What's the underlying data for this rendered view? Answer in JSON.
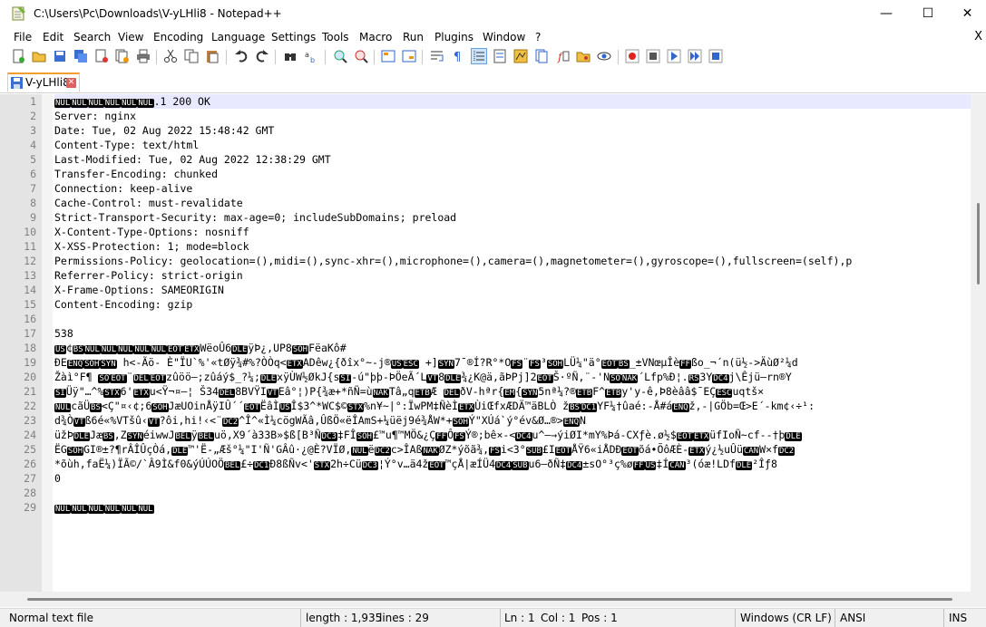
{
  "window": {
    "title": "C:\\Users\\Pc\\Downloads\\V-yLHli8 - Notepad++",
    "minimize": "—",
    "maximize": "☐",
    "close": "✕"
  },
  "menu": [
    "File",
    "Edit",
    "Search",
    "View",
    "Encoding",
    "Language",
    "Settings",
    "Tools",
    "Macro",
    "Run",
    "Plugins",
    "Window",
    "?"
  ],
  "menu_close": "X",
  "tab": {
    "label": "V-yLHli8",
    "close": "✕"
  },
  "line_numbers": [
    "1",
    "2",
    "3",
    "4",
    "5",
    "6",
    "7",
    "8",
    "9",
    "10",
    "11",
    "12",
    "13",
    "14",
    "15",
    "16",
    "17",
    "18",
    "19",
    "20",
    "21",
    "22",
    "23",
    "24",
    "25",
    "26",
    "27",
    "28",
    "29"
  ],
  "lines": {
    "l1": ".1 200 OK",
    "l2": "Server: nginx",
    "l3": "Date: Tue, 02 Aug 2022 15:48:42 GMT",
    "l4": "Content-Type: text/html",
    "l5": "Last-Modified: Tue, 02 Aug 2022 12:38:29 GMT",
    "l6": "Transfer-Encoding: chunked",
    "l7": "Connection: keep-alive",
    "l8": "Cache-Control: must-revalidate",
    "l9": "Strict-Transport-Security: max-age=0; includeSubDomains; preload",
    "l10": "X-Content-Type-Options: nosniff",
    "l11": "X-XSS-Protection: 1; mode=block",
    "l12": "Permissions-Policy: geolocation=(),midi=(),sync-xhr=(),microphone=(),camera=(),magnetometer=(),gyroscope=(),fullscreen=(self),p",
    "l13": "Referrer-Policy: strict-origin",
    "l14": "X-Frame-Options: SAMEORIGIN",
    "l15": "Content-Encoding: gzip",
    "l16": "",
    "l17": "538",
    "l18b": "WëoÛ6",
    "l18c": "ÿÞ¿,UP8",
    "l18d": "FëaKô#",
    "l19a": "ÐE",
    "l19b": " h<-Ãö- È\"ÏU`%'«tØÿ¾#%?ÒÒq<",
    "l19c": "ADêw¿{ðîx°~-j®",
    "l19d": " +]",
    "l19e": "7¯®Í?R°*O",
    "l19f": "LÜ¼\"ä°",
    "l19g": "_±VNœµÎè",
    "l19h": "ßo_¬´n(ü½->ÄùØ²¼d",
    "l20a": "Žàì°F¶ ",
    "l20b": "zûöö—;zûáý$_?¼;",
    "l20c": "xÿÙW½ØkJ{s",
    "l20d": "-ú\"þþ-ÞÖeÃ´L",
    "l20e": "¾¿K@ä,ãÞPj]2",
    "l20f": "Š·ºÑ,¨-'N",
    "l20g": "´Lfp%Ð¦.",
    "l20h": "3Y",
    "l20i": "j\\Êjü—rn®Y",
    "l21a": "",
    "l21b": "Üÿ\"…^%",
    "l21c": "6'",
    "l21d": "u<Ÿ¬¤—¦ Š34",
    "l21e": "8BVŸI",
    "l21f": "Eâ°¦)P{¾æ+*ñÑ=ù",
    "l21g": "Tâ„q",
    "l21h": "ðV-hªr{",
    "l21i": "5nª¼?®",
    "l21j": "F^",
    "l21k": "y'y-ê,Þ8èââ$¯EÇ",
    "l21l": "uqtš×",
    "l22a": "cãÜ",
    "l22b": "<Ç\"¤‹¢;6",
    "l22c": "JæUOinÅÿIÛ´´",
    "l22d": "ËâÌ",
    "l22e": "Î$3^*WC$©",
    "l22f": "%n¥~|°:ÏwPM‡ÑèÌ",
    "l22g": "ÙiŒfxÆDÄ™äBLÒ ž",
    "l22h": "YF¼†ûaé:-Å#á",
    "l22i": "ž,-|GÖb=Œ>E´-km¢‹÷¹:",
    "l23a": "d¾Ò",
    "l23b": "ß6é«%VTšû‹",
    "l23c": "?ôi,hi!‹<¨",
    "l23d": "^Î^«Ì¼cögWÃâ,ÛßÖ«ëÎAmS+¼üëj9é¾ÅW*+",
    "l23e": "Ý\"XÚá`ý°év&Ø…®>",
    "l23f": "N",
    "l24a": "üžÞ",
    "l24b": "Jæ",
    "l24c": ",Z",
    "l24d": "éiwwJ",
    "l24e": "ÿ",
    "l24f": "uö,X9´à33B»$ß[B³Ñ",
    "l24g": "‡FÎ",
    "l24h": "£™u¶™MÖ&¿Ç",
    "l24i": "Ý®;bê×-<",
    "l24j": "u^—→ýiØI*mY%Þá-CXƒè.ø½$",
    "l24k": "üfIoÑ~cf--†þ",
    "l25a": "ËG",
    "l25b": "GI®±?¶rÂÎÛçÒá,",
    "l25c": "™'Ë-„Æš°¼\"I'Ñ'GÂû·¿@È?VÏØ,",
    "l25d": "ë",
    "l25e": "c>ÎAß",
    "l25f": "ØZ*ýõã¾,",
    "l25g": "i<3°",
    "l25h": "£I",
    "l25i": "ÅŸ6«iÅDÐ",
    "l25j": "õá•ÕôÆÈ-",
    "l25k": "ý¿½uÛü",
    "l25l": "W×f",
    "l26a": "*õùh,faË¼)ÏÃ©/`Â9Ì&f0&ýÚÚOÖ",
    "l26b": "£÷",
    "l26c": "Ð8ßÑv<'",
    "l26d": "2h÷Cü",
    "l26e": "¦Ý°v…ä4ž",
    "l26f": "™çÅ|æÍÜ4",
    "l26g": "u6—ðÑ‡",
    "l26h": "±sO°³ç%ø",
    "l26i": "‡Í",
    "l26j": "³(óæ!LDf",
    "l26k": "²Îƒ8",
    "l27": "0",
    "l28": "",
    "l29": ""
  },
  "status": {
    "type": "Normal text file",
    "length": "length : 1,935",
    "lines": "lines : 29",
    "ln": "Ln : 1",
    "col": "Col : 1",
    "pos": "Pos : 1",
    "eol": "Windows (CR LF)",
    "encoding": "ANSI",
    "mode": "INS"
  }
}
